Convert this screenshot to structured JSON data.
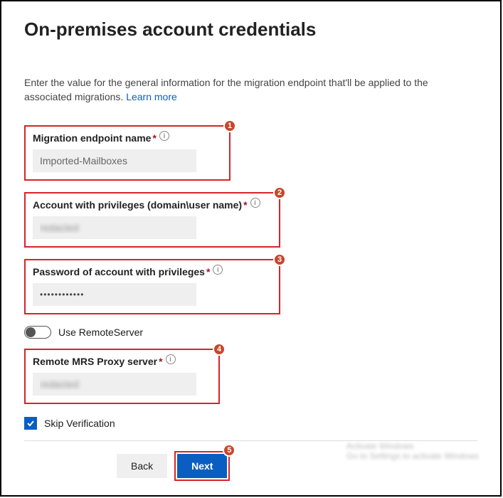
{
  "heading": "On-premises account credentials",
  "intro_text": "Enter the value for the general information for the migration endpoint that'll be applied to the associated migrations. ",
  "learn_more": "Learn more",
  "fields": {
    "endpoint": {
      "label": "Migration endpoint name",
      "value": "Imported-Mailboxes",
      "badge": "1"
    },
    "account": {
      "label": "Account with privileges (domain\\user name)",
      "value": "redacted",
      "badge": "2"
    },
    "password": {
      "label": "Password of account with privileges",
      "value": "••••••••••••",
      "badge": "3"
    },
    "proxy": {
      "label": "Remote MRS Proxy server",
      "value": "redacted",
      "badge": "4"
    }
  },
  "toggle": {
    "label": "Use RemoteServer",
    "on": false
  },
  "skip_verification": {
    "label": "Skip Verification",
    "checked": true
  },
  "buttons": {
    "back": "Back",
    "next": "Next",
    "next_badge": "5"
  }
}
